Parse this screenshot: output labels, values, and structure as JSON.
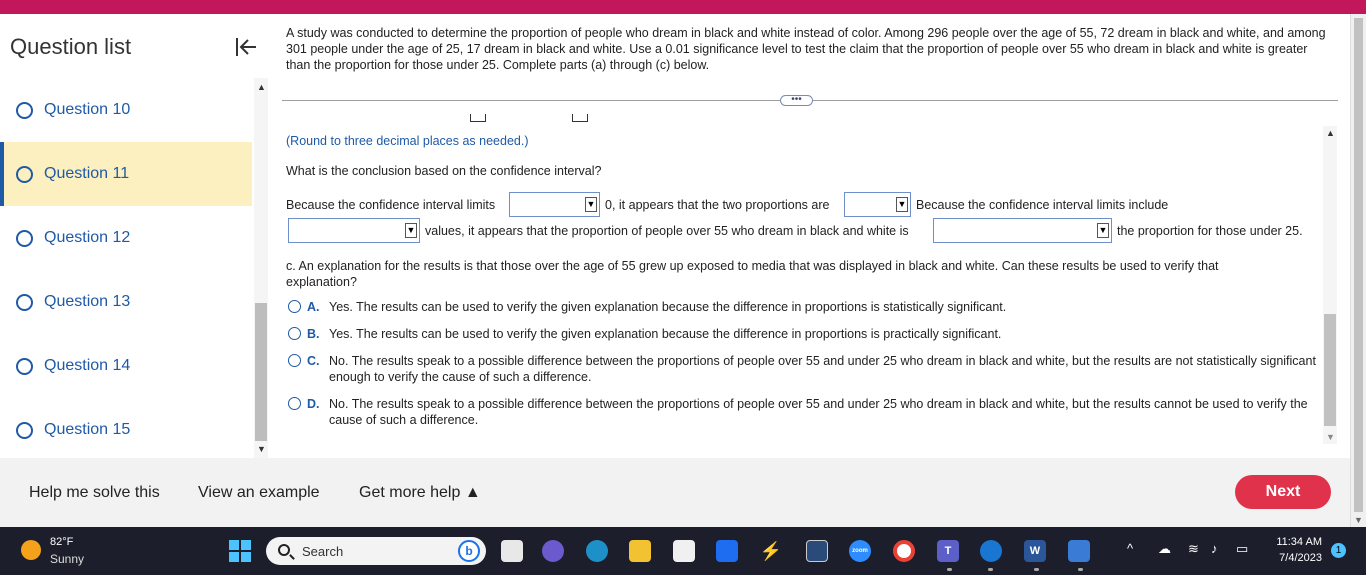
{
  "sidebar": {
    "title": "Question list",
    "items": [
      {
        "label": "Question 10",
        "active": false
      },
      {
        "label": "Question 11",
        "active": true
      },
      {
        "label": "Question 12",
        "active": false
      },
      {
        "label": "Question 13",
        "active": false
      },
      {
        "label": "Question 14",
        "active": false
      },
      {
        "label": "Question 15",
        "active": false
      }
    ]
  },
  "problem": {
    "text": "A study was conducted to determine the proportion of people who dream in black and white instead of color. Among 296 people over the age of 55, 72 dream in black and white, and among 301 people under the age of 25, 17 dream in black and white. Use a 0.01 significance level to test the claim that the proportion of people over 55 who dream in black and white is greater than the proportion for those under 25. Complete parts (a) through (c) below.",
    "more_label": "•••"
  },
  "work": {
    "round_note": "(Round to three decimal places as needed.)",
    "conclusion_question": "What is the conclusion based on the confidence interval?",
    "sentence": {
      "part1": "Because the confidence interval limits",
      "part2": "0, it appears that the two proportions are",
      "part3": "Because the confidence interval limits include",
      "part4": "values, it appears that the proportion of people over 55 who dream in black and white is",
      "part5": "the proportion for those under 25."
    },
    "part_c_question": "c. An explanation for the results is that those over the age of 55 grew up exposed to media that was displayed in black and white. Can these results be used to verify that explanation?",
    "options": [
      {
        "letter": "A.",
        "text": "Yes. The results can be used to verify the given explanation because the difference in proportions is statistically significant."
      },
      {
        "letter": "B.",
        "text": "Yes. The results can be used to verify the given explanation because the difference in proportions is practically significant."
      },
      {
        "letter": "C.",
        "text": "No. The results speak to a possible difference between the proportions of people over 55 and under 25 who dream in black and white, but the results are not statistically significant enough to verify the cause of such a difference."
      },
      {
        "letter": "D.",
        "text": "No. The results speak to a possible difference between the proportions of people over 55 and under 25 who dream in black and white, but the results cannot be used to verify the cause of such a difference."
      }
    ]
  },
  "bottom": {
    "help_solve": "Help me solve this",
    "view_example": "View an example",
    "more_help": "Get more help ▲",
    "next": "Next"
  },
  "taskbar": {
    "temp": "82°F",
    "condition": "Sunny",
    "search_label": "Search",
    "time": "11:34 AM",
    "date": "7/4/2023",
    "notif_count": "1",
    "zoom_label": "zoom",
    "word_label": "W",
    "teams_label": "T"
  },
  "colors": {
    "accent": "#1f5aa6",
    "active_bg": "#fcefc0",
    "next_button": "#e0324b",
    "top_bar": "#c2185b"
  }
}
